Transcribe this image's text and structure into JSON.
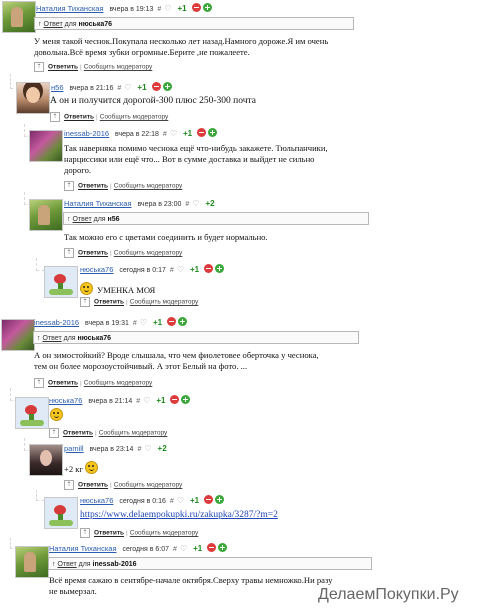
{
  "comments": [
    {
      "author": "Наталия Тиханская",
      "time": "вчера в 19:13",
      "hash": "#",
      "heart": "♡",
      "score": "+1",
      "reply_to_label": "Ответ",
      "reply_to_word": "для",
      "reply_to_name": "нюська76",
      "text_lines": [
        "У меня такой чеснок.Покупала несколько лет назад.Намного дороже.Я им очень",
        "довольна.Всё время зубки огромные.Берите ,не пожалеете."
      ],
      "reply": "Ответить",
      "sep": "|",
      "report": "Сообщить модератору"
    },
    {
      "author": "н56",
      "time": "вчера в 21:16",
      "hash": "#",
      "heart": "♡",
      "score": "+1",
      "text_lines": [
        "А он и получится дорогой-300 плюс 250-300 почта"
      ],
      "reply": "Ответить",
      "sep": "|",
      "report": "Сообщить модератору"
    },
    {
      "author": "inessab-2016",
      "time": "вчера в 22:18",
      "hash": "#",
      "heart": "♡",
      "score": "+1",
      "text_lines": [
        "Так наверняка помимо чеснока ещё что-нибудь закажете. Тюльпанчики,",
        "нарциссики или ещё что... Вот в сумме доставка и выйдет не сильно",
        "дорого."
      ],
      "reply": "Ответить",
      "sep": "|",
      "report": "Сообщить модератору"
    },
    {
      "author": "Наталия Тиханская",
      "time": "вчера в 23:00",
      "hash": "#",
      "heart": "♡",
      "score": "+2",
      "reply_to_label": "Ответ",
      "reply_to_word": "для",
      "reply_to_name": "н56",
      "text_lines": [
        "Так можно его с цветами соединить и будет нормально."
      ],
      "reply": "Ответить",
      "sep": "|",
      "report": "Сообщить модератору"
    },
    {
      "author": "нюська76",
      "time": "сегодня в 0:17",
      "hash": "#",
      "heart": "♡",
      "score": "+1",
      "text_lines": [
        "УМЕНКА МОЯ"
      ],
      "reply": "Ответить",
      "sep": "|",
      "report": "Сообщить модератору"
    },
    {
      "author": "inessab-2016",
      "time": "вчера в 19:31",
      "hash": "#",
      "heart": "♡",
      "score": "+1",
      "reply_to_label": "Ответ",
      "reply_to_word": "для",
      "reply_to_name": "нюська76",
      "text_lines": [
        "А он зимостойкий? Вроде слышала, что чем фиолетовее оберточка у чеснока,",
        "тем он более морозоустойчивый. А этот Белый на фото. ..."
      ],
      "reply": "Ответить",
      "sep": "|",
      "report": "Сообщить модератору"
    },
    {
      "author": "нюська76",
      "time": "вчера в 21:14",
      "hash": "#",
      "heart": "♡",
      "score": "+1",
      "text_lines": [
        ""
      ],
      "reply": "Ответить",
      "sep": "|",
      "report": "Сообщить модератору"
    },
    {
      "author": "pamill",
      "time": "вчера в 23:14",
      "hash": "#",
      "heart": "♡",
      "score": "+2",
      "text_lines": [
        "+2 кг"
      ],
      "reply": "Ответить",
      "sep": "|",
      "report": "Сообщить модератору"
    },
    {
      "author": "нюська76",
      "time": "сегодня в 0:16",
      "hash": "#",
      "heart": "♡",
      "score": "+1",
      "text_lines": [
        "https://www.delaempokupki.ru/zakupka/3287/?m=2"
      ],
      "reply": "Ответить",
      "sep": "|",
      "report": "Сообщить модератору"
    },
    {
      "author": "Наталия Тиханская",
      "time": "сегодня в 6:07",
      "hash": "#",
      "heart": "♡",
      "score": "+1",
      "reply_to_label": "Ответ",
      "reply_to_word": "для",
      "reply_to_name": "inessab-2016",
      "text_lines": [
        "Всё время сажаю в сентябре-начале октября.Сверху травы немножко.Ни разу",
        "не вымерзал."
      ],
      "reply": "Ответить",
      "sep": "|",
      "report": "Сообщить модератору"
    }
  ],
  "icons": {
    "anchor": "⇡",
    "reply_arrow": "↑"
  },
  "colors": {
    "author_link": "#2a5db0",
    "score_green": "#1b8a1b",
    "vote_minus": "#dd3b3b",
    "vote_plus": "#38a738"
  },
  "watermark": "ДелаемПокупки.Ру"
}
